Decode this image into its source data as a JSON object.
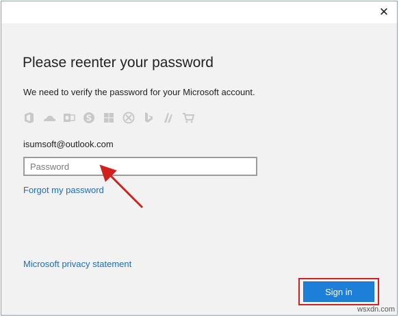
{
  "window": {
    "close_glyph": "✕"
  },
  "dialog": {
    "title": "Please reenter your password",
    "description": "We need to verify the password for your Microsoft account.",
    "service_icons": [
      "office-icon",
      "onedrive-icon",
      "outlook-icon",
      "skype-icon",
      "windows-icon",
      "xbox-icon",
      "bing-icon",
      "msn-icon",
      "store-icon"
    ],
    "email": "isumsoft@outlook.com",
    "password_placeholder": "Password",
    "forgot_link": "Forgot my password",
    "privacy_link": "Microsoft privacy statement",
    "sign_in_label": "Sign in"
  },
  "colors": {
    "accent": "#1e7fd8",
    "link": "#1a6fc2",
    "annotation": "#d0211f",
    "icon_gray": "#c8c8c8",
    "background": "#f2f2f2"
  },
  "watermark": "wsxdn.com"
}
